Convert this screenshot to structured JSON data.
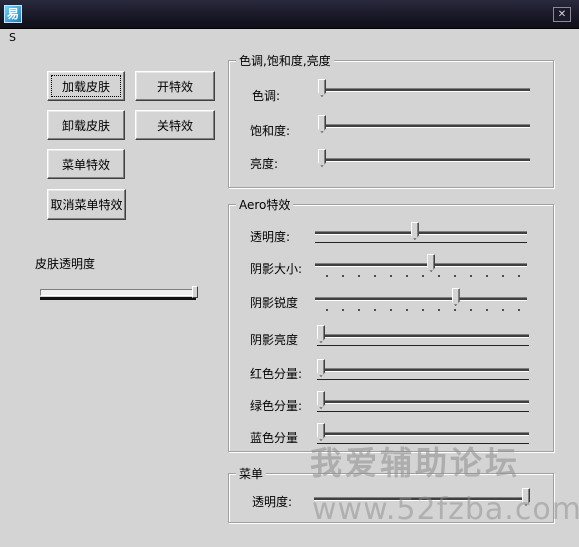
{
  "window": {
    "title": "",
    "close_glyph": "✕",
    "app_icon_glyph": "易"
  },
  "menu": {
    "item": "S"
  },
  "buttons": {
    "load_skin": "加载皮肤",
    "unload_skin": "卸载皮肤",
    "menu_effect": "菜单特效",
    "cancel_menu_effect": "取消菜单特效",
    "effect_on": "开特效",
    "effect_off": "关特效"
  },
  "skin_opacity": {
    "label": "皮肤透明度",
    "value_fraction": 1.0
  },
  "hsl_group": {
    "title": "色调,饱和度,亮度",
    "sliders": [
      {
        "label": "色调:",
        "value_fraction": 0.0
      },
      {
        "label": "饱和度:",
        "value_fraction": 0.0
      },
      {
        "label": "亮度:",
        "value_fraction": 0.0
      }
    ]
  },
  "aero_group": {
    "title": "Aero特效",
    "sliders": [
      {
        "label": "透明度:",
        "value_fraction": 0.47
      },
      {
        "label": "阴影大小:",
        "value_fraction": 0.55
      },
      {
        "label": "阴影锐度",
        "value_fraction": 0.67
      },
      {
        "label": "阴影亮度",
        "value_fraction": 0.0
      },
      {
        "label": "红色分量:",
        "value_fraction": 0.0
      },
      {
        "label": "绿色分量:",
        "value_fraction": 0.0
      },
      {
        "label": "蓝色分量",
        "value_fraction": 0.0
      }
    ]
  },
  "menu_group": {
    "title": "菜单",
    "slider": {
      "label": "透明度:",
      "value_fraction": 1.0
    }
  },
  "watermark": {
    "text_cn": "我爱辅助论坛",
    "url": "www.52fzba.com"
  }
}
